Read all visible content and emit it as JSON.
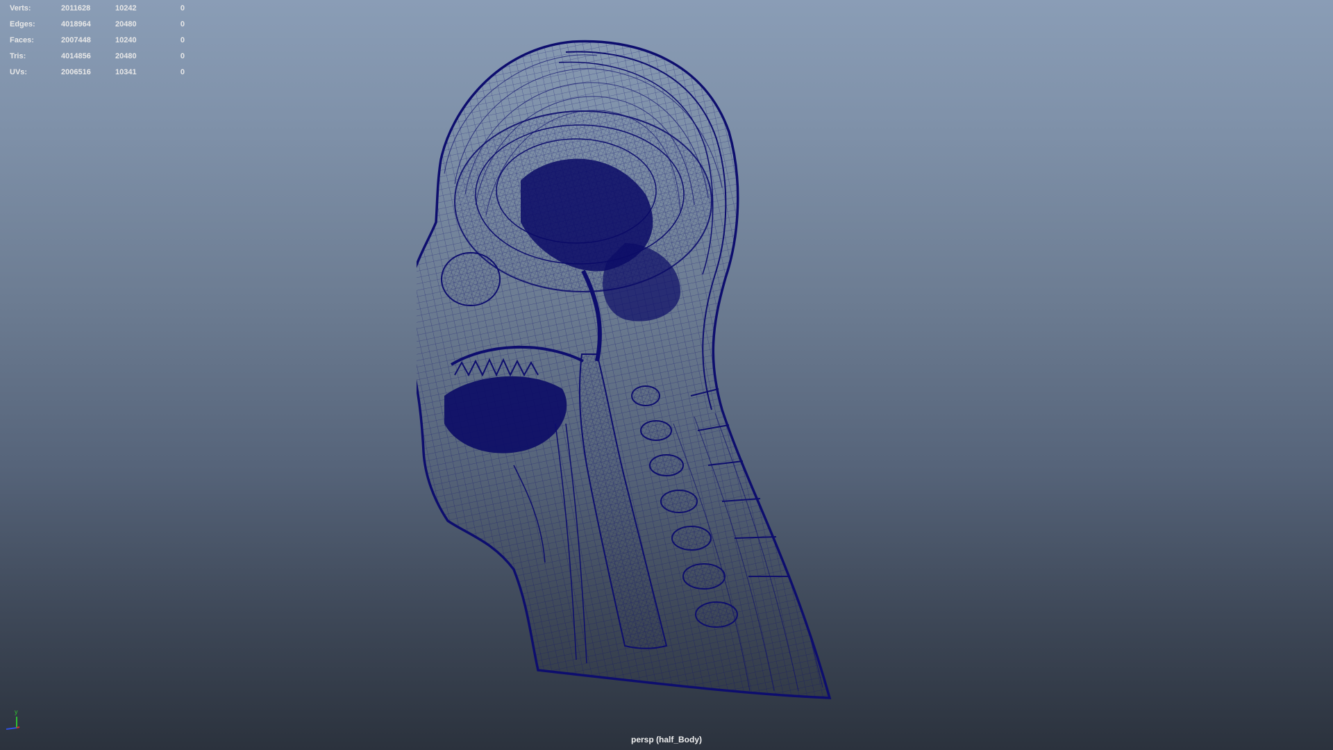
{
  "heads_up": {
    "rows": [
      {
        "label": "Verts:",
        "c1": "2011628",
        "c2": "10242",
        "c3": "0"
      },
      {
        "label": "Edges:",
        "c1": "4018964",
        "c2": "20480",
        "c3": "0"
      },
      {
        "label": "Faces:",
        "c1": "2007448",
        "c2": "10240",
        "c3": "0"
      },
      {
        "label": "Tris:",
        "c1": "4014856",
        "c2": "20480",
        "c3": "0"
      },
      {
        "label": "UVs:",
        "c1": "2006516",
        "c2": "10341",
        "c3": "0"
      }
    ]
  },
  "viewport": {
    "camera_label": "persp (half_Body)",
    "wire_color": "#0d0d6e"
  },
  "axis_gizmo": {
    "y_label": "y",
    "x_color": "#d03030",
    "y_color": "#30c030",
    "z_color": "#3050e0"
  }
}
